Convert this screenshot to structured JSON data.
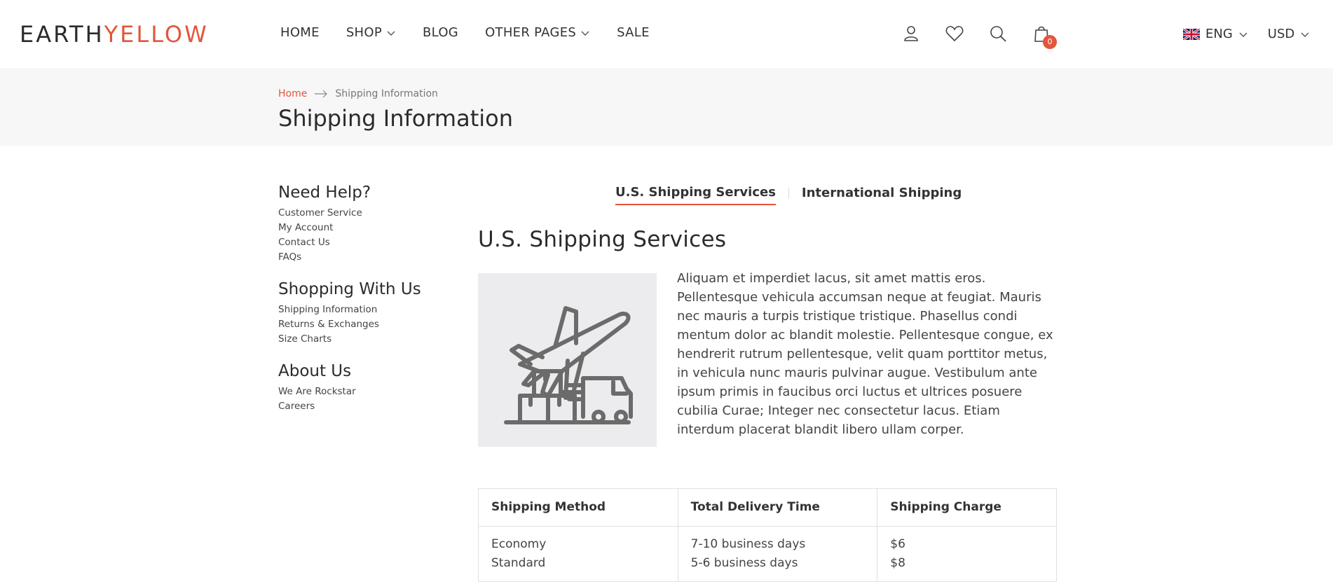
{
  "logo": {
    "part1": "EARTH",
    "part2": "YELLOW"
  },
  "nav": {
    "home": "HOME",
    "shop": "SHOP",
    "blog": "BLOG",
    "other_pages": "OTHER PAGES",
    "sale": "SALE"
  },
  "header_icons": [
    "user-icon",
    "heart-icon",
    "search-icon",
    "cart-icon"
  ],
  "cart": {
    "count": "0"
  },
  "locale": {
    "language": "ENG",
    "currency": "USD"
  },
  "breadcrumb": {
    "home": "Home",
    "current": "Shipping Information"
  },
  "page_title": "Shipping Information",
  "sidebar": {
    "groups": [
      {
        "heading": "Need Help?",
        "links": [
          "Customer Service",
          "My Account",
          "Contact Us",
          "FAQs"
        ]
      },
      {
        "heading": "Shopping With Us",
        "links": [
          "Shipping Information",
          "Returns & Exchanges",
          "Size Charts"
        ]
      },
      {
        "heading": "About Us",
        "links": [
          "We Are Rockstar",
          "Careers"
        ]
      }
    ]
  },
  "tabs": {
    "us": "U.S. Shipping Services",
    "intl": "International Shipping"
  },
  "section": {
    "title": "U.S. Shipping Services",
    "paragraph": "Aliquam et imperdiet lacus, sit amet mattis eros. Pellentesque vehicula accumsan neque at feugiat. Mauris nec mauris a turpis tristique tristique. Phasellus condi mentum dolor ac blandit molestie. Pellentesque congue, ex hendrerit rutrum pellentesque, velit quam porttitor metus, in vehicula nunc mauris pulvinar augue. Vestibulum ante ipsum primis in faucibus orci luctus et ultrices posuere cubilia Curae; Integer nec consectetur lacus. Etiam interdum placerat blandit libero ullam corper."
  },
  "table": {
    "headers": [
      "Shipping Method",
      "Total Delivery Time",
      "Shipping Charge"
    ],
    "rows": [
      [
        "Economy",
        "7-10 business days",
        "$6"
      ],
      [
        "Standard",
        "5-6 business days",
        "$8"
      ]
    ]
  },
  "colors": {
    "accent": "#e2563b",
    "band": "#f7f7f7",
    "text": "#333333"
  }
}
